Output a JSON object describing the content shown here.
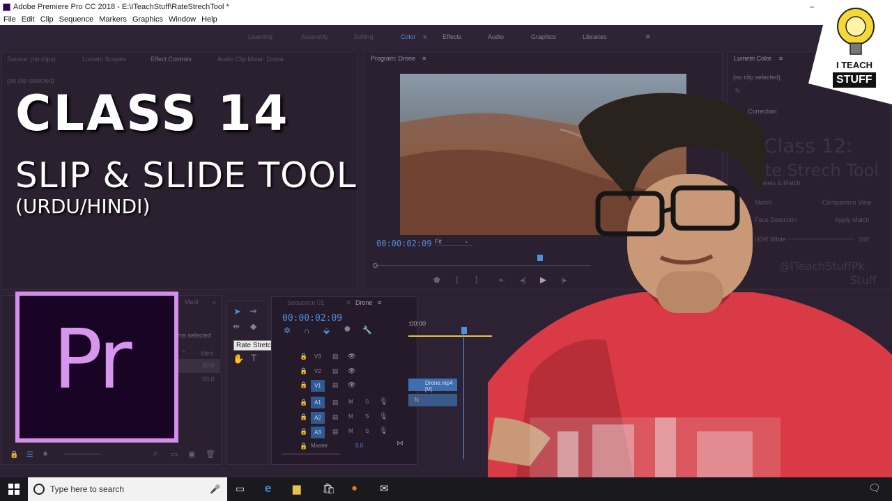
{
  "window": {
    "title": "Adobe Premiere Pro CC 2018 - E:\\ITeachStuff\\RateStrechTool *",
    "minimize": "–",
    "maximize": "☐",
    "close": "✕"
  },
  "menu": [
    "File",
    "Edit",
    "Clip",
    "Sequence",
    "Markers",
    "Graphics",
    "Window",
    "Help"
  ],
  "workspaces": [
    "Learning",
    "Assembly",
    "Editing",
    "Color",
    "Effects",
    "Audio",
    "Graphics",
    "Libraries"
  ],
  "workspaces_more": "»",
  "source_panel": {
    "tabs": [
      "Source: (no clips)",
      "Lumetri Scopes",
      "Effect Controls",
      "Audio Clip Mixer: Drone"
    ],
    "no_clip": "(no clip selected)"
  },
  "program_monitor": {
    "title": "Program: Drone",
    "timecode": "00:00:02:09",
    "fit": "Fit"
  },
  "lumetri": {
    "title": "Lumetri Color",
    "no_clip": "(no clip selected)",
    "fx": "fx",
    "correction": "Correction",
    "wheels": "Wheels & Match",
    "match": "Match",
    "face": "Face Detection",
    "comparison": "Comparison View",
    "apply": "Apply Match",
    "hdr": "HDR White",
    "hdr_val": "100"
  },
  "overlay": {
    "class": "CLASS 14",
    "tool": "SLIP & SLIDE TOOL",
    "lang": "(URDU/HINDI)",
    "bg_class": "Class 12:",
    "bg_tool": "ate Strech Tool",
    "bg_handle": "@ITeachStuffPk",
    "bg_stuff": "Stuff"
  },
  "pr_logo": "Pr",
  "project_panel": {
    "items_selected": "ems selected",
    "media_col": "Med",
    "row1": "00:0",
    "row2": "00:0",
    "tab": "Medi"
  },
  "tools": {
    "tooltip": "Rate Stretch Tool (R)"
  },
  "timeline": {
    "tab_inactive": "Sequence 01",
    "tab_active": "Drone",
    "timecode": "00:00:02:09",
    "ruler": ":00:00",
    "tracks": [
      "V3",
      "V2",
      "V1",
      "A1",
      "A2",
      "A3"
    ],
    "master": "Master",
    "master_val": "0.0",
    "clip": "Drone.mp4 [V]",
    "fx": "fx"
  },
  "brand": {
    "line1": "I TEACH",
    "line2": "STUFF"
  },
  "taskbar": {
    "search_placeholder": "Type here to search"
  },
  "colors": {
    "accent": "#4d8fe0",
    "pr_purple": "#d796ee",
    "shirt": "#d93a45"
  }
}
